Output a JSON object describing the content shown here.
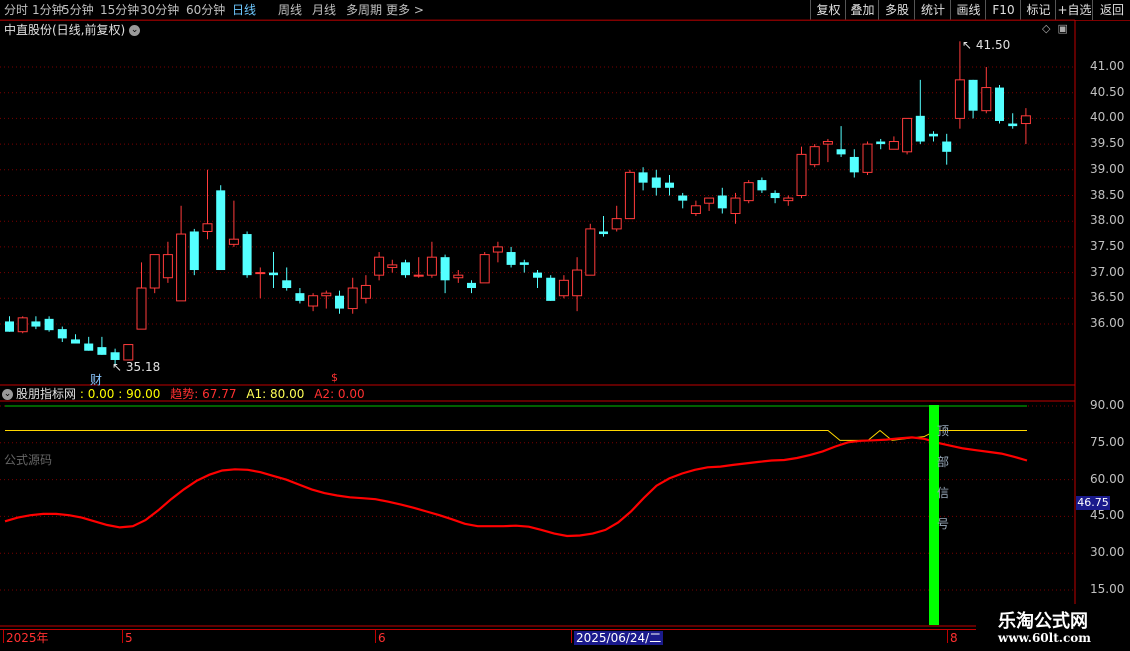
{
  "toolbar": {
    "left_items": [
      "分时",
      "1分钟",
      "5分钟",
      "15分钟",
      "30分钟",
      "60分钟",
      "日线",
      "周线",
      "月线",
      "多周期",
      "更多 >"
    ],
    "active": "日线",
    "right_items": [
      "复权",
      "叠加",
      "多股",
      "统计",
      "画线",
      "F10",
      "标记",
      "+自选",
      "返回"
    ]
  },
  "stock": {
    "title": "中直股份(日线,前复权)"
  },
  "price_axis": {
    "labels": [
      "41.00",
      "40.50",
      "40.00",
      "39.50",
      "39.00",
      "38.50",
      "38.00",
      "37.50",
      "37.00",
      "36.50",
      "36.00"
    ]
  },
  "annotations": {
    "high": "41.50",
    "low": "35.18",
    "cai": "财",
    "dollar": "$"
  },
  "indicator": {
    "name": "股朋指标网",
    "params": ": 0.00 : 90.00",
    "trend_label": "趋势: 67.77",
    "a1_label": "A1: 80.00",
    "a2_label": "A2: 0.00",
    "source_label": "公式源码",
    "current_value": "46.75",
    "axis_labels": [
      "90.00",
      "75.00",
      "60.00",
      "45.00",
      "30.00",
      "15.00"
    ],
    "vertical_text": [
      "顶",
      "部",
      "信",
      "号"
    ]
  },
  "xaxis": {
    "labels": [
      "2025年",
      "5",
      "6",
      "2025/06/24/二",
      "8"
    ],
    "selected": "2025/06/24/二"
  },
  "watermark": {
    "name": "乐淘公式网",
    "url": "www.60lt.com"
  },
  "colors": {
    "up": "#ff3b3b",
    "down": "#54ffff",
    "trend_line": "#ff0000",
    "a1_line": "#ffd700",
    "level_line": "#00c000",
    "signal_bar": "#00ff00"
  },
  "chart_data": [
    {
      "type": "candlestick",
      "title": "中直股份(日线,前复权)",
      "ylim": [
        35.4,
        41.9
      ],
      "ohlc": [
        [
          36.05,
          36.15,
          35.85,
          35.85
        ],
        [
          35.85,
          36.15,
          35.82,
          36.12
        ],
        [
          36.05,
          36.15,
          35.9,
          35.95
        ],
        [
          36.1,
          36.15,
          35.85,
          35.88
        ],
        [
          35.9,
          35.95,
          35.65,
          35.72
        ],
        [
          35.7,
          35.8,
          35.62,
          35.62
        ],
        [
          35.62,
          35.75,
          35.48,
          35.48
        ],
        [
          35.55,
          35.75,
          35.4,
          35.4
        ],
        [
          35.45,
          35.52,
          35.18,
          35.3
        ],
        [
          35.3,
          35.6,
          35.3,
          35.6
        ],
        [
          35.9,
          37.2,
          35.9,
          36.7
        ],
        [
          36.7,
          37.3,
          36.6,
          37.35
        ],
        [
          36.9,
          37.6,
          36.8,
          37.35
        ],
        [
          36.45,
          38.3,
          36.45,
          37.75
        ],
        [
          37.8,
          37.85,
          36.95,
          37.05
        ],
        [
          37.8,
          39.0,
          37.65,
          37.95
        ],
        [
          38.6,
          38.7,
          37.65,
          37.05
        ],
        [
          37.55,
          38.4,
          37.5,
          37.65
        ],
        [
          37.75,
          37.8,
          36.9,
          36.95
        ],
        [
          37.0,
          37.1,
          36.5,
          37.0
        ],
        [
          37.0,
          37.4,
          36.7,
          36.95
        ],
        [
          36.85,
          37.1,
          36.65,
          36.7
        ],
        [
          36.6,
          36.7,
          36.4,
          36.45
        ],
        [
          36.35,
          36.6,
          36.25,
          36.55
        ],
        [
          36.55,
          36.65,
          36.3,
          36.6
        ],
        [
          36.55,
          36.65,
          36.2,
          36.3
        ],
        [
          36.3,
          36.9,
          36.2,
          36.7
        ],
        [
          36.5,
          36.95,
          36.4,
          36.75
        ],
        [
          36.95,
          37.4,
          36.85,
          37.3
        ],
        [
          37.1,
          37.25,
          37.0,
          37.15
        ],
        [
          37.2,
          37.25,
          36.9,
          36.95
        ],
        [
          36.95,
          37.3,
          36.9,
          36.95
        ],
        [
          36.95,
          37.6,
          36.9,
          37.3
        ],
        [
          37.3,
          37.35,
          36.6,
          36.85
        ],
        [
          36.9,
          37.05,
          36.8,
          36.95
        ],
        [
          36.8,
          36.85,
          36.6,
          36.7
        ],
        [
          36.8,
          37.4,
          36.8,
          37.35
        ],
        [
          37.4,
          37.6,
          37.2,
          37.5
        ],
        [
          37.4,
          37.5,
          37.1,
          37.15
        ],
        [
          37.2,
          37.25,
          37.0,
          37.15
        ],
        [
          37.0,
          37.05,
          36.7,
          36.9
        ],
        [
          36.9,
          36.95,
          36.45,
          36.45
        ],
        [
          36.55,
          36.95,
          36.5,
          36.85
        ],
        [
          36.55,
          37.3,
          36.25,
          37.05
        ],
        [
          36.95,
          37.95,
          36.95,
          37.85
        ],
        [
          37.8,
          38.1,
          37.7,
          37.75
        ],
        [
          37.85,
          38.3,
          37.8,
          38.05
        ],
        [
          38.05,
          39.0,
          38.05,
          38.95
        ],
        [
          38.95,
          39.05,
          38.6,
          38.75
        ],
        [
          38.85,
          39.0,
          38.5,
          38.65
        ],
        [
          38.75,
          38.9,
          38.5,
          38.65
        ],
        [
          38.5,
          38.55,
          38.25,
          38.4
        ],
        [
          38.15,
          38.4,
          38.1,
          38.3
        ],
        [
          38.35,
          38.45,
          38.2,
          38.45
        ],
        [
          38.5,
          38.65,
          38.15,
          38.25
        ],
        [
          38.15,
          38.55,
          37.95,
          38.45
        ],
        [
          38.4,
          38.8,
          38.35,
          38.75
        ],
        [
          38.8,
          38.85,
          38.55,
          38.6
        ],
        [
          38.55,
          38.6,
          38.35,
          38.45
        ],
        [
          38.4,
          38.5,
          38.3,
          38.45
        ],
        [
          38.5,
          39.45,
          38.45,
          39.3
        ],
        [
          39.1,
          39.5,
          39.05,
          39.45
        ],
        [
          39.5,
          39.6,
          39.15,
          39.55
        ],
        [
          39.4,
          39.85,
          39.25,
          39.3
        ],
        [
          39.25,
          39.4,
          38.85,
          38.95
        ],
        [
          38.95,
          39.55,
          38.9,
          39.5
        ],
        [
          39.55,
          39.6,
          39.4,
          39.5
        ],
        [
          39.4,
          39.65,
          39.4,
          39.55
        ],
        [
          39.35,
          40.0,
          39.3,
          40.0
        ],
        [
          40.05,
          40.75,
          39.5,
          39.55
        ],
        [
          39.7,
          39.75,
          39.55,
          39.65
        ],
        [
          39.55,
          39.7,
          39.1,
          39.35
        ],
        [
          40.0,
          41.5,
          39.8,
          40.75
        ],
        [
          40.75,
          40.75,
          40.0,
          40.15
        ],
        [
          40.15,
          41.0,
          40.1,
          40.6
        ],
        [
          40.6,
          40.65,
          39.9,
          39.95
        ],
        [
          39.9,
          40.1,
          39.8,
          39.85
        ],
        [
          39.9,
          40.2,
          39.5,
          40.05
        ]
      ]
    },
    {
      "type": "line",
      "title": "股朋指标网",
      "ylim": [
        9,
        95
      ],
      "series": [
        {
          "name": "趋势",
          "values": [
            43,
            44.5,
            45.5,
            46,
            46,
            45.5,
            44.5,
            43,
            41.5,
            40.5,
            41,
            43.5,
            47.5,
            52,
            56,
            59.5,
            62,
            63.7,
            64.2,
            64,
            63,
            61.5,
            60,
            58,
            56,
            54.5,
            53.5,
            52.8,
            52.4,
            52,
            51,
            49.8,
            48.5,
            47,
            45.5,
            43.8,
            42,
            41,
            41,
            41,
            41.2,
            40.8,
            39.5,
            38,
            37,
            37.2,
            38,
            39.5,
            42.5,
            47,
            52.5,
            57.5,
            60.5,
            62.5,
            64,
            65,
            65.3,
            66,
            66.6,
            67.2,
            67.8,
            68,
            68.8,
            70,
            71.5,
            73.5,
            75.2,
            75.8,
            76,
            76.3,
            76.8,
            77.2,
            76.6,
            75,
            73.8,
            72.7,
            72,
            71.3,
            70.6,
            69.3,
            67.77
          ]
        },
        {
          "name": "A1",
          "values": [
            80
          ]
        },
        {
          "name": "A2",
          "values": [
            0
          ]
        }
      ]
    }
  ]
}
